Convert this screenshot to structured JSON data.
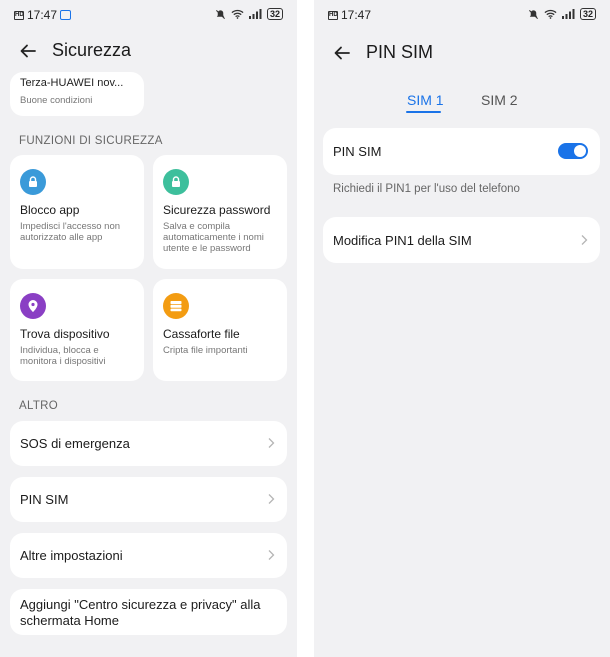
{
  "status_bar": {
    "time": "17:47",
    "battery": "32"
  },
  "left_screen": {
    "title": "Sicurezza",
    "partial_card": {
      "title": "Terza-HUAWEI nov...",
      "subtitle": "Buone condizioni"
    },
    "security_section_label": "FUNZIONI DI SICUREZZA",
    "tiles": [
      {
        "title": "Blocco app",
        "desc": "Impedisci l'accesso non autorizzato alle app",
        "color": "#3a9ad9",
        "icon": "lock-icon"
      },
      {
        "title": "Sicurezza password",
        "desc": "Salva e compila automaticamente i nomi utente e le password",
        "color": "#3dbf9c",
        "icon": "lock-icon"
      },
      {
        "title": "Trova dispositivo",
        "desc": "Individua, blocca e monitora i dispositivi",
        "color": "#8a3fc4",
        "icon": "location-pin-icon"
      },
      {
        "title": "Cassaforte file",
        "desc": "Cripta file importanti",
        "color": "#f39c12",
        "icon": "safe-icon"
      }
    ],
    "other_section_label": "ALTRO",
    "rows": [
      {
        "label": "SOS di emergenza"
      },
      {
        "label": "PIN SIM"
      },
      {
        "label": "Altre impostazioni"
      }
    ],
    "add_home_row": "Aggiungi \"Centro sicurezza e privacy\" alla schermata Home"
  },
  "right_screen": {
    "title": "PIN SIM",
    "tabs": [
      {
        "label": "SIM 1",
        "active": true
      },
      {
        "label": "SIM 2",
        "active": false
      }
    ],
    "pin_toggle": {
      "label": "PIN SIM",
      "enabled": true
    },
    "pin_hint": "Richiedi il PIN1 per l'uso del telefono",
    "modify_row": "Modifica PIN1 della SIM"
  },
  "colors": {
    "accent": "#1a73e8",
    "background": "#f1f1f3",
    "card": "#ffffff"
  }
}
